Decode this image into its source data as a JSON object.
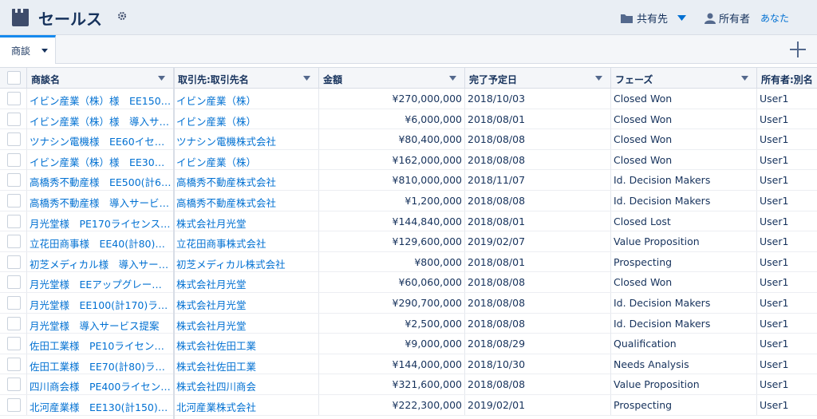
{
  "header": {
    "title": "セールス",
    "shared_label": "共有先",
    "owner_label": "所有者",
    "owner_value": "あなた"
  },
  "tabs": [
    {
      "label": "商談"
    }
  ],
  "colors": {
    "link": "#0070d2",
    "text": "#16325c",
    "header_bg": "#e9eef4"
  },
  "table": {
    "columns": [
      "商談名",
      "取引先:取引先名",
      "金額",
      "完了予定日",
      "フェーズ",
      "所有者:別名"
    ],
    "rows": [
      [
        "イビン産業（株）様　EE150…",
        "イビン産業（株）",
        "¥270,000,000",
        "2018/10/03",
        "Closed Won",
        "User1"
      ],
      [
        "イビン産業（株）様　導入サ…",
        "イビン産業（株）",
        "¥6,000,000",
        "2018/08/01",
        "Closed Won",
        "User1"
      ],
      [
        "ツナシン電機様　EE60イセ…",
        "ツナシン電機株式会社",
        "¥80,400,000",
        "2018/08/08",
        "Closed Won",
        "User1"
      ],
      [
        "イビン産業（株）様　EE30…",
        "イビン産業（株）",
        "¥162,000,000",
        "2018/08/08",
        "Closed Won",
        "User1"
      ],
      [
        "高橋秀不動産様　EE500(計6…",
        "高橋秀不動産株式会社",
        "¥810,000,000",
        "2018/11/07",
        "Id. Decision Makers",
        "User1"
      ],
      [
        "高橋秀不動産様　導入サービ…",
        "高橋秀不動産株式会社",
        "¥1,200,000",
        "2018/08/08",
        "Id. Decision Makers",
        "User1"
      ],
      [
        "月光堂様　PE170ライセンス…",
        "株式会社月光堂",
        "¥144,840,000",
        "2018/08/01",
        "Closed Lost",
        "User1"
      ],
      [
        "立花田商事様　EE40(計80)…",
        "立花田商事株式会社",
        "¥129,600,000",
        "2019/02/07",
        "Value Proposition",
        "User1"
      ],
      [
        "初芝メディカル様　導入サー…",
        "初芝メディカル株式会社",
        "¥800,000",
        "2018/08/01",
        "Prospecting",
        "User1"
      ],
      [
        "月光堂様　EEアップグレー…",
        "株式会社月光堂",
        "¥60,060,000",
        "2018/08/08",
        "Closed Won",
        "User1"
      ],
      [
        "月光堂様　EE100(計170)ラ…",
        "株式会社月光堂",
        "¥290,700,000",
        "2018/08/08",
        "Id. Decision Makers",
        "User1"
      ],
      [
        "月光堂様　導入サービス提案",
        "株式会社月光堂",
        "¥2,500,000",
        "2018/08/08",
        "Id. Decision Makers",
        "User1"
      ],
      [
        "佐田工業様　PE10ライセン…",
        "株式会社佐田工業",
        "¥9,000,000",
        "2018/08/29",
        "Qualification",
        "User1"
      ],
      [
        "佐田工業様　EE70(計80)ラ…",
        "株式会社佐田工業",
        "¥144,000,000",
        "2018/10/30",
        "Needs Analysis",
        "User1"
      ],
      [
        "四川商会様　PE400ライセン…",
        "株式会社四川商会",
        "¥321,600,000",
        "2018/08/08",
        "Value Proposition",
        "User1"
      ],
      [
        "北河産業様　EE130(計150)…",
        "北河産業株式会社",
        "¥222,300,000",
        "2019/02/01",
        "Prospecting",
        "User1"
      ]
    ]
  }
}
